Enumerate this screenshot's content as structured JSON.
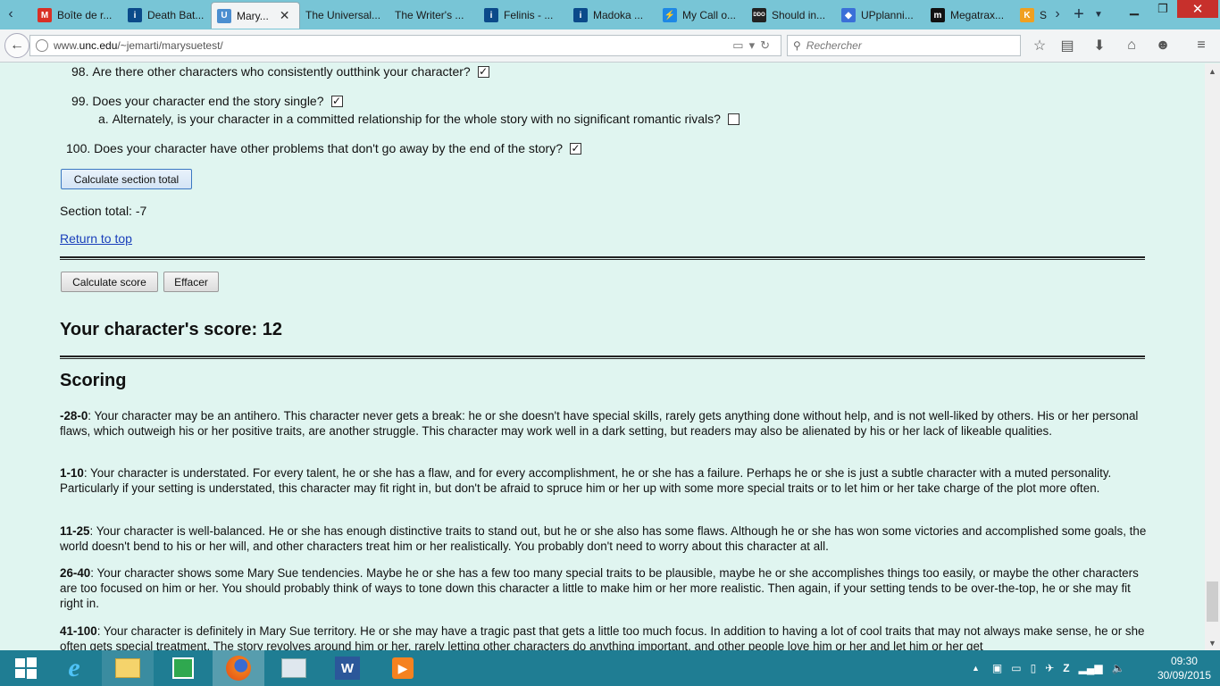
{
  "browser": {
    "tabs": [
      {
        "label": "Boîte de r...",
        "icon": "gmail-icon",
        "color": "#d93025",
        "glyph": "M"
      },
      {
        "label": "Death Bat...",
        "icon": "wiki-icon",
        "color": "#0b4a8a",
        "glyph": "i"
      },
      {
        "label": "Mary...",
        "icon": "unc-icon",
        "color": "#4b8ed0",
        "glyph": "U",
        "active": true
      },
      {
        "label": "The Universal...",
        "icon": "",
        "color": "",
        "glyph": ""
      },
      {
        "label": "The Writer's ...",
        "icon": "",
        "color": "",
        "glyph": ""
      },
      {
        "label": "Felinis - ...",
        "icon": "wiki-icon",
        "color": "#0b4a8a",
        "glyph": "i"
      },
      {
        "label": "Madoka ...",
        "icon": "wiki-icon",
        "color": "#0b4a8a",
        "glyph": "i"
      },
      {
        "label": "My Call o...",
        "icon": "feather-icon",
        "color": "#1e88e5",
        "glyph": "⚡"
      },
      {
        "label": "Should in...",
        "icon": "ddo-icon",
        "color": "#222",
        "glyph": "DDO"
      },
      {
        "label": "UPplanni...",
        "icon": "up-icon",
        "color": "#3a6fd8",
        "glyph": "◆"
      },
      {
        "label": "Megatrax...",
        "icon": "m-icon",
        "color": "#111",
        "glyph": "m"
      },
      {
        "label": "S",
        "icon": "k-icon",
        "color": "#f0a020",
        "glyph": "K"
      }
    ],
    "url_prefix": "www.",
    "url_domain": "unc.edu",
    "url_path": "/~jemarti/marysuetest/",
    "search_placeholder": "Rechercher"
  },
  "questions": [
    {
      "num": "98.",
      "text": "Are there other characters who consistently outthink your character?",
      "checked": true
    },
    {
      "num": "99.",
      "text": "Does your character end the story single?",
      "checked": true
    },
    {
      "num": "a.",
      "text": "Alternately, is your character in a committed relationship for the whole story with no significant romantic rivals?",
      "checked": false
    },
    {
      "num": "100.",
      "text": "Does your character have other problems that don't go away by the end of the story?",
      "checked": true
    }
  ],
  "buttons": {
    "calc_section": "Calculate section total",
    "calc_score": "Calculate score",
    "clear": "Effacer"
  },
  "section_total": "Section total: -7",
  "return_top": "Return to top",
  "score_heading": "Your character's score: 12",
  "scoring_heading": "Scoring",
  "scoring": [
    {
      "range": "-28-0",
      "text": ": Your character may be an antihero. This character never gets a break: he or she doesn't have special skills, rarely gets anything done without help, and is not well-liked by others. His or her personal flaws, which outweigh his or her positive traits, are another struggle. This character may work well in a dark setting, but readers may also be alienated by his or her lack of likeable qualities."
    },
    {
      "range": "1-10",
      "text": ": Your character is understated. For every talent, he or she has a flaw, and for every accomplishment, he or she has a failure. Perhaps he or she is just a subtle character with a muted personality. Particularly if your setting is understated, this character may fit right in, but don't be afraid to spruce him or her up with some more special traits or to let him or her take charge of the plot more often."
    },
    {
      "range": "11-25",
      "text": ": Your character is well-balanced. He or she has enough distinctive traits to stand out, but he or she also has some flaws. Although he or she has won some victories and accomplished some goals, the world doesn't bend to his or her will, and other characters treat him or her realistically. You probably don't need to worry about this character at all."
    },
    {
      "range": "26-40",
      "text": ": Your character shows some Mary Sue tendencies. Maybe he or she has a few too many special traits to be plausible, maybe he or she accomplishes things too easily, or maybe the other characters are too focused on him or her. You should probably think of ways to tone down this character a little to make him or her more realistic. Then again, if your setting tends to be over-the-top, he or she may fit right in."
    },
    {
      "range": "41-100",
      "text": ": Your character is definitely in Mary Sue territory. He or she may have a tragic past that gets a little too much focus. In addition to having a lot of cool traits that may not always make sense, he or she often gets special treatment. The story revolves around him or her, rarely letting other characters do anything important, and other people love him or her and let him or her get"
    }
  ],
  "taskbar": {
    "time": "09:30",
    "date": "30/09/2015"
  }
}
